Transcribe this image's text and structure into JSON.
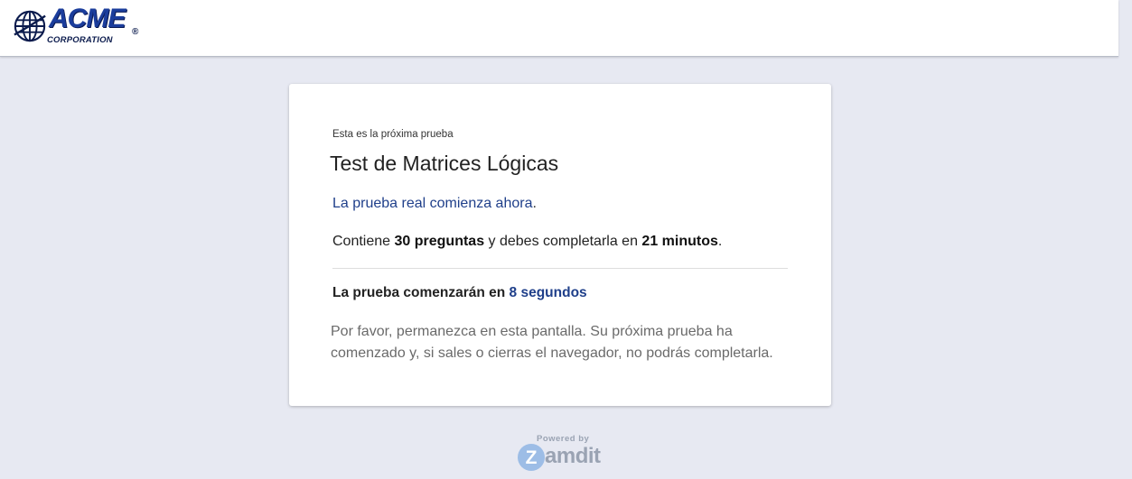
{
  "header": {
    "logo": {
      "name": "ACME",
      "subtitle": "CORPORATION",
      "registered": "®",
      "icon": "globe-icon"
    }
  },
  "card": {
    "eyebrow": "Esta es la próxima prueba",
    "title": "Test de Matrices Lógicas",
    "starts_now": "La prueba real comienza ahora",
    "starts_now_suffix": ".",
    "contains": {
      "prefix": "Contiene ",
      "questions": "30 preguntas",
      "middle": " y debes completarla en ",
      "minutes": "21 minutos",
      "suffix": "."
    },
    "countdown": {
      "prefix": "La prueba comenzarán en ",
      "time": "8 segundos"
    },
    "note": "Por favor, permanezca en esta pantalla. Su próxima prueba ha comenzado y, si sales o cierras el navegador, no podrás completarla."
  },
  "footer": {
    "powered_by": "Powered by",
    "brand": "amdit",
    "brand_initial": "Z"
  },
  "colors": {
    "accent": "#1f3f8a",
    "background": "#e7e9f2",
    "logo_blue": "#1b3d9c"
  }
}
